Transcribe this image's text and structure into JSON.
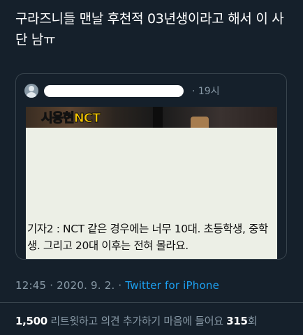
{
  "tweet": {
    "text": "구라즈니들 맨날 후천적 03년생이라고 해서 이 사단 남ㅠ"
  },
  "quoted_tweet": {
    "time": "· 19시",
    "image_caption_prefix": "시웅현",
    "image_caption_accent": "NCT",
    "body_text": "기자2 : NCT 같은 경우에는 너무 10대. 초등학생, 중학생. 그리고 20대 이후는 전혀 몰라요."
  },
  "meta": {
    "timestamp": "12:45 · 2020. 9. 2. · ",
    "source": "Twitter for iPhone"
  },
  "stats": {
    "retweets": "1,500",
    "retweets_label": " 리트윗하고 의견 추가하기  마음에 들어요 ",
    "likes": "315",
    "likes_label": "회"
  },
  "colors": {
    "background": "#15202b",
    "link": "#1da1f2",
    "secondary_text": "#8899a6"
  }
}
